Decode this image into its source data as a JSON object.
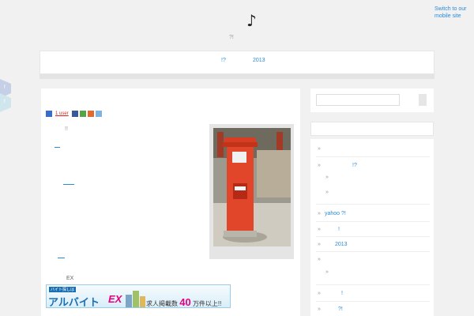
{
  "header": {
    "mobile_link": "Switch to our mobile site",
    "title": "♪",
    "description": "?!"
  },
  "nav": {
    "items": [
      "!?",
      "2013"
    ]
  },
  "side_tabs": [
    "f",
    "f"
  ],
  "post": {
    "share": {
      "users_count": "1 user"
    },
    "excl": "!!",
    "ex_text": "EX"
  },
  "banner": {
    "top_label": "バイト探しは",
    "brand": "アルバイト",
    "brand_ex": "EX",
    "tagline_a": "求人掲載数",
    "tagline_num": "40",
    "tagline_b": "万件以上!!"
  },
  "sidebar": {
    "items": [
      {
        "text": ""
      },
      {
        "text": "!?"
      },
      {
        "text": ""
      },
      {
        "text": ""
      },
      {
        "text": "yahoo ?!"
      },
      {
        "text": "!"
      },
      {
        "text": "2013"
      },
      {
        "text": ""
      },
      {
        "text": ""
      },
      {
        "text": "!"
      },
      {
        "text": "?!"
      }
    ]
  },
  "colors": {
    "accent": "#2a8bd8",
    "postbox_red": "#e2462a",
    "background": "#f1f1f1"
  }
}
